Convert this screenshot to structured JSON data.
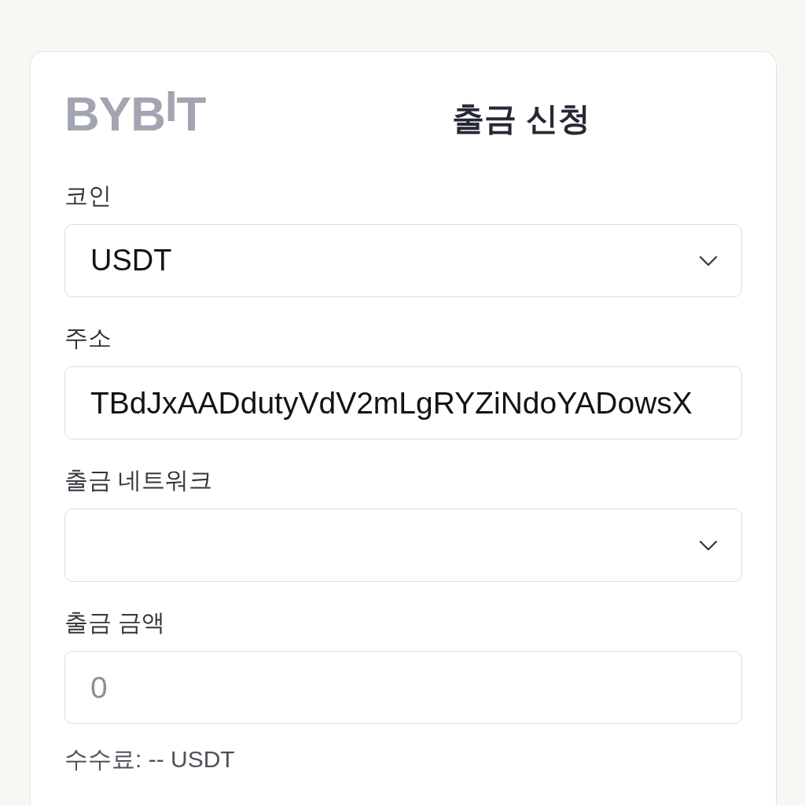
{
  "logo": {
    "text": "BYB$^{I}$T"
  },
  "title": "출금 신청",
  "fields": [
    {
      "kind": "select",
      "label": "코인",
      "value": "USDT"
    },
    {
      "kind": "input",
      "label": "주소",
      "value": "TBdJxAADdutyVdV2mLgRYZiNdoYADowsX"
    },
    {
      "kind": "select",
      "label": "출금 네트워크"
    },
    {
      "kind": "input",
      "label": "출금 금액",
      "placeholder": "0"
    }
  ],
  "fee_note": "수수료: -- USDT"
}
